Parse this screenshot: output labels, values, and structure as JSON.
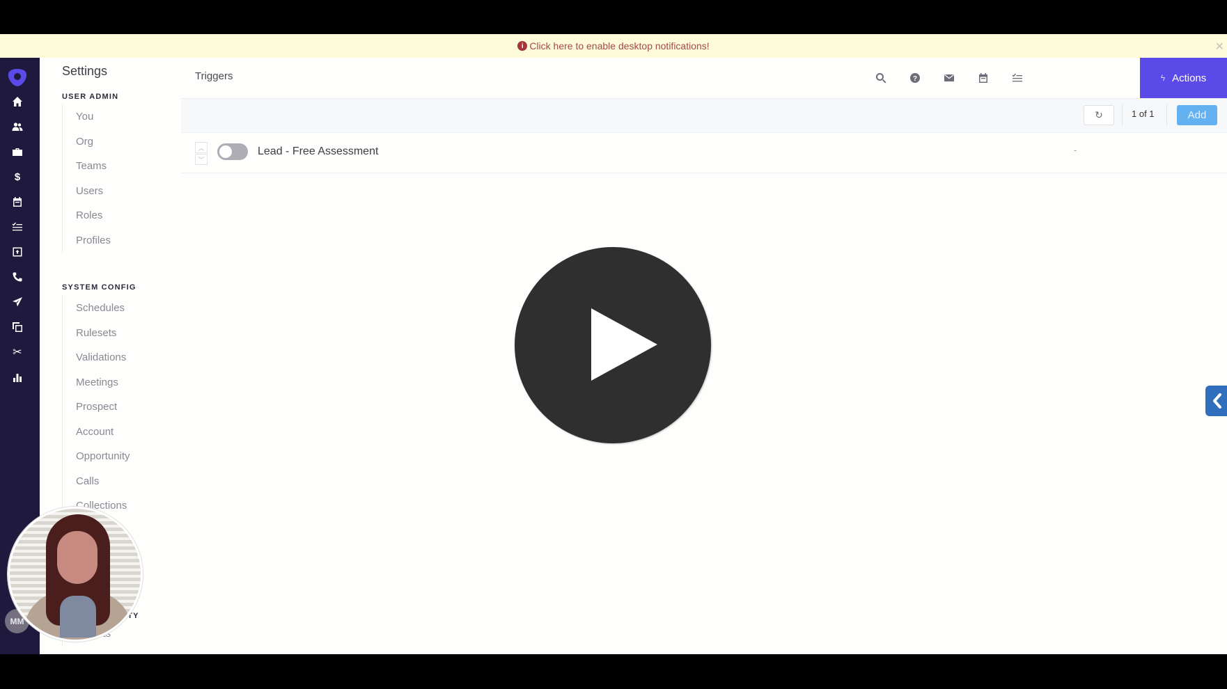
{
  "notification": {
    "text": "Click here to enable desktop notifications!",
    "icon": "alert-circle-icon",
    "close_icon": "close-icon"
  },
  "rail": {
    "logo": "app-logo",
    "items": [
      {
        "name": "home",
        "icon": "home-icon"
      },
      {
        "name": "people",
        "icon": "people-icon"
      },
      {
        "name": "accounts",
        "icon": "briefcase-icon"
      },
      {
        "name": "opportunities",
        "icon": "dollar-icon"
      },
      {
        "name": "calendar",
        "icon": "calendar-icon"
      },
      {
        "name": "tasks",
        "icon": "checklist-icon"
      },
      {
        "name": "inbox",
        "icon": "inbox-icon"
      },
      {
        "name": "calls",
        "icon": "phone-icon"
      },
      {
        "name": "sequences",
        "icon": "send-icon"
      },
      {
        "name": "templates",
        "icon": "copy-icon"
      },
      {
        "name": "snippets",
        "icon": "scissors-icon"
      },
      {
        "name": "reports",
        "icon": "bar-chart-icon"
      }
    ],
    "avatar_initials": "MM"
  },
  "settings": {
    "title": "Settings",
    "sections": [
      {
        "label": "USER ADMIN",
        "items": [
          "You",
          "Org",
          "Teams",
          "Users",
          "Roles",
          "Profiles"
        ]
      },
      {
        "label": "SYSTEM CONFIG",
        "items": [
          "Schedules",
          "Rulesets",
          "Validations",
          "Meetings",
          "Prospect",
          "Account",
          "Opportunity",
          "Calls",
          "Collections"
        ]
      },
      {
        "label_partial": ".TY",
        "items": [
          "Imports"
        ]
      }
    ]
  },
  "main": {
    "title": "Triggers",
    "header_icons": [
      "search-icon",
      "help-icon",
      "mail-icon",
      "calendar-icon",
      "checklist-icon"
    ],
    "actions_label": "Actions",
    "toolbar": {
      "refresh_icon": "refresh-icon",
      "page_count": "1 of 1",
      "add_label": "Add"
    },
    "triggers": [
      {
        "name": "Lead - Free Assessment",
        "enabled": false,
        "trailing": "-"
      }
    ]
  },
  "overlay": {
    "play_button": "play-icon",
    "side_tab_icon": "chevron-left-icon",
    "webcam": "presenter-webcam"
  }
}
